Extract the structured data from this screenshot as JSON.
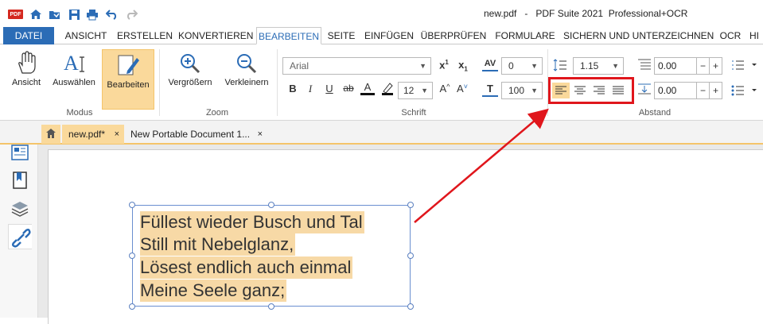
{
  "title_bar": {
    "app_logo": "PDF",
    "window_title": "new.pdf   -   PDF Suite 2021  Professional+OCR",
    "quick_access_icons": [
      "home-icon",
      "open-folder-icon",
      "save-icon",
      "print-icon",
      "undo-icon",
      "redo-icon"
    ]
  },
  "menu_tabs": [
    {
      "label": "DATEI"
    },
    {
      "label": "ANSICHT"
    },
    {
      "label": "ERSTELLEN"
    },
    {
      "label": "KONVERTIEREN"
    },
    {
      "label": "BEARBEITEN"
    },
    {
      "label": "SEITE"
    },
    {
      "label": "EINFÜGEN"
    },
    {
      "label": "ÜBERPRÜFEN"
    },
    {
      "label": "FORMULARE"
    },
    {
      "label": "SICHERN UND UNTERZEICHNEN"
    },
    {
      "label": "OCR"
    },
    {
      "label": "HI"
    }
  ],
  "ribbon": {
    "modus": {
      "label": "Modus",
      "buttons": [
        {
          "label": "Ansicht"
        },
        {
          "label": "Auswählen"
        },
        {
          "label": "Bearbeiten",
          "active": true
        }
      ]
    },
    "zoom": {
      "label": "Zoom",
      "buttons": [
        {
          "label": "Vergrößern"
        },
        {
          "label": "Verkleinern"
        }
      ]
    },
    "schrift": {
      "label": "Schrift",
      "font_name": "Arial",
      "font_size": "12",
      "char_spacing": "0",
      "scale": "100",
      "format_buttons": [
        "B",
        "I",
        "U",
        "ab",
        "A",
        "A^",
        "A˅"
      ]
    },
    "abstand": {
      "label": "Abstand",
      "line_spacing": "1.15",
      "space_before": "0.00",
      "space_after": "0.00",
      "alignment_buttons": [
        "align-left-icon",
        "align-center-icon",
        "align-right-icon",
        "align-justify-icon"
      ],
      "selected_alignment": "align-left-icon"
    }
  },
  "document_tabs": [
    {
      "label": "new.pdf*",
      "close": "×"
    },
    {
      "label": "New Portable Document 1...",
      "close": "×"
    }
  ],
  "sidebar": {
    "expand": ">",
    "icons": [
      "page-thumbnails-icon",
      "bookmarks-icon",
      "layers-icon",
      "links-icon"
    ]
  },
  "document": {
    "text_lines": [
      "Füllest wieder Busch und Tal",
      "Still mit Nebelglanz,",
      "Lösest endlich auch einmal",
      "Meine Seele ganz;"
    ]
  },
  "colors": {
    "accent": "#2b6cb6",
    "active_button": "#fad99b",
    "selection": "#f7d9a6",
    "annotation_red": "#e0161c"
  }
}
